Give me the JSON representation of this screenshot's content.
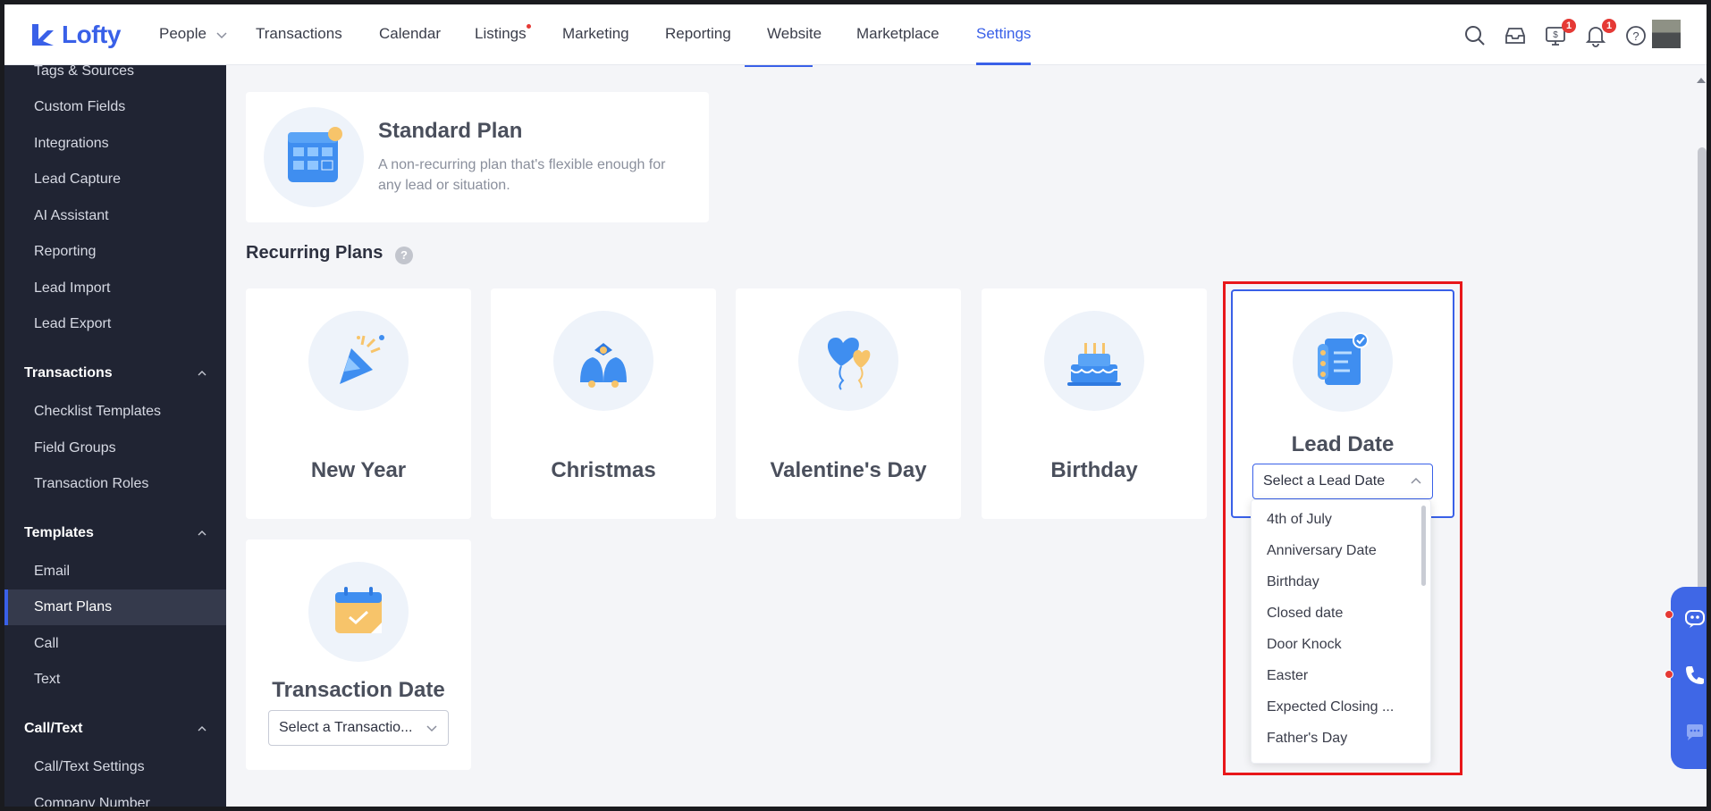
{
  "app": {
    "brand": "Lofty",
    "accent": "#3960e8"
  },
  "nav": {
    "items": [
      {
        "label": "People",
        "has_dropdown": true
      },
      {
        "label": "Transactions"
      },
      {
        "label": "Calendar"
      },
      {
        "label": "Listings",
        "has_dot": true
      },
      {
        "label": "Marketing"
      },
      {
        "label": "Reporting"
      },
      {
        "label": "Website"
      },
      {
        "label": "Marketplace"
      },
      {
        "label": "Settings",
        "active": true
      }
    ],
    "icons": [
      "search-icon",
      "inbox-icon",
      "billing-icon",
      "bell-icon",
      "help-icon"
    ],
    "billing_badge": "1",
    "bell_badge": "1"
  },
  "sidebar": {
    "items_top": [
      "Tags & Sources",
      "Custom Fields",
      "Integrations",
      "Lead Capture",
      "AI Assistant",
      "Reporting",
      "Lead Import",
      "Lead Export"
    ],
    "transactions": {
      "title": "Transactions",
      "items": [
        "Checklist Templates",
        "Field Groups",
        "Transaction Roles"
      ]
    },
    "templates": {
      "title": "Templates",
      "items": [
        "Email",
        "Smart Plans",
        "Call",
        "Text"
      ],
      "active": "Smart Plans"
    },
    "calltext": {
      "title": "Call/Text",
      "items": [
        "Call/Text Settings",
        "Company Number"
      ]
    }
  },
  "standard_plan": {
    "title": "Standard Plan",
    "description": "A non-recurring plan that's flexible enough for any lead or situation."
  },
  "recurring": {
    "title": "Recurring Plans",
    "help": "?",
    "cards": [
      {
        "title": "New Year",
        "icon": "party-popper-icon"
      },
      {
        "title": "Christmas",
        "icon": "bells-icon"
      },
      {
        "title": "Valentine's Day",
        "icon": "heart-balloons-icon"
      },
      {
        "title": "Birthday",
        "icon": "cake-icon"
      }
    ],
    "lead_date": {
      "title": "Lead Date",
      "placeholder": "Select a Lead Date",
      "options": [
        "4th of July",
        "Anniversary Date",
        "Birthday",
        "Closed date",
        "Door Knock",
        "Easter",
        "Expected Closing ...",
        "Father's Day"
      ]
    },
    "transaction_date": {
      "title": "Transaction Date",
      "placeholder": "Select a Transactio..."
    }
  }
}
